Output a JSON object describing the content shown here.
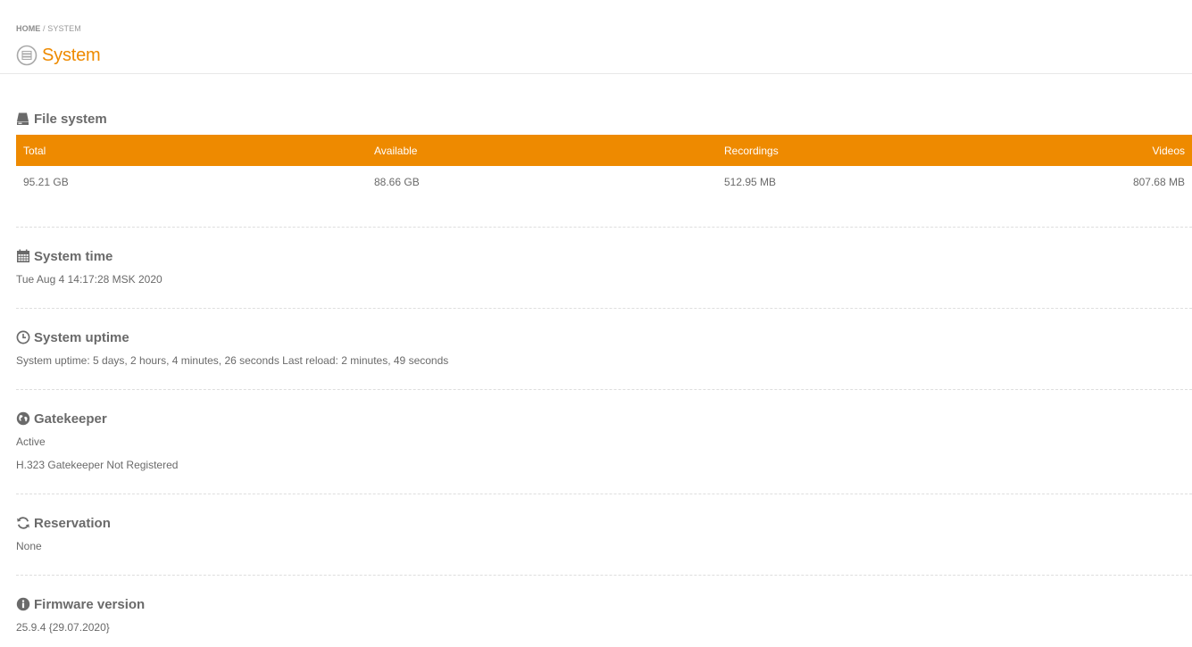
{
  "breadcrumb": {
    "home": "HOME",
    "separator": "/",
    "current": "SYSTEM"
  },
  "page": {
    "title": "System",
    "accent_color": "#ee8a00",
    "title_icon": "server-icon"
  },
  "file_system": {
    "title": "File system",
    "icon": "hard-drive-icon",
    "columns": [
      "Total",
      "Available",
      "Recordings",
      "Videos"
    ],
    "row": [
      "95.21 GB",
      "88.66 GB",
      "512.95 MB",
      "807.68 MB"
    ]
  },
  "system_time": {
    "title": "System time",
    "icon": "calendar-icon",
    "value": "Tue Aug 4 14:17:28 MSK 2020"
  },
  "system_uptime": {
    "title": "System uptime",
    "icon": "clock-icon",
    "value": "System uptime: 5 days, 2 hours, 4 minutes, 26 seconds Last reload: 2 minutes, 49 seconds"
  },
  "gatekeeper": {
    "title": "Gatekeeper",
    "icon": "globe-icon",
    "status": "Active",
    "detail": "H.323 Gatekeeper Not Registered"
  },
  "reservation": {
    "title": "Reservation",
    "icon": "refresh-icon",
    "value": "None"
  },
  "firmware": {
    "title": "Firmware version",
    "icon": "info-icon",
    "value": "25.9.4 {29.07.2020}"
  }
}
